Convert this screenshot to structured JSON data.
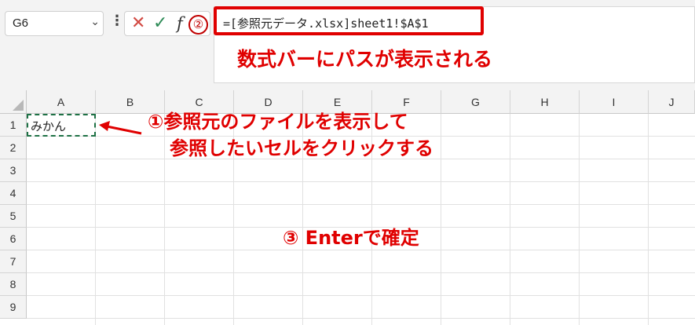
{
  "name_box": {
    "value": "G6"
  },
  "formula_bar": {
    "cancel_icon": "close-icon",
    "enter_icon": "check-icon",
    "fx_label": "f",
    "formula": "=[参照元データ.xlsx]sheet1!$A$1"
  },
  "columns": [
    "A",
    "B",
    "C",
    "D",
    "E",
    "F",
    "G",
    "H",
    "I",
    "J"
  ],
  "rows": [
    "1",
    "2",
    "3",
    "4",
    "5",
    "6",
    "7",
    "8",
    "9"
  ],
  "cells": {
    "A1": "みかん"
  },
  "annotations": {
    "badge2": "②",
    "note_formula": "数式バーにパスが表示される",
    "note_step1_line1": "①参照元のファイルを表示して",
    "note_step1_line2": "参照したいセルをクリックする",
    "note_step3": "③ Enterで確定"
  },
  "colors": {
    "annotation": "#e00000",
    "selection": "#1e7145"
  }
}
